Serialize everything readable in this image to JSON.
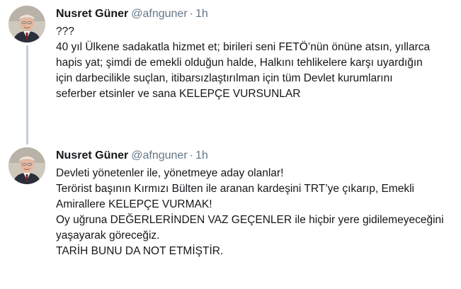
{
  "tweets": [
    {
      "author_name": "Nusret Güner",
      "handle": "@afnguner",
      "separator": "·",
      "time": "1h",
      "lines": [
        "???",
        "40 yıl Ülkene sadakatla hizmet et; birileri seni FETÖ’nün önüne atsın, yıllarca",
        "hapis yat; şimdi de emekli olduğun halde, Halkını tehlikelere karşı uyardığın",
        "için darbecilikle suçlan, itibarsızlaştırılman için tüm Devlet kurumlarını",
        "seferber etsinler ve sana KELEPÇE VURSUNLAR"
      ]
    },
    {
      "author_name": "Nusret Güner",
      "handle": "@afnguner",
      "separator": "·",
      "time": "1h",
      "lines": [
        "Devleti yönetenler ile, yönetmeye aday olanlar!",
        "Terörist başının Kırmızı Bülten ile aranan kardeşini TRT’ye çıkarıp, Emekli",
        "Amirallere KELEPÇE VURMAK!",
        "Oy uğruna DEĞERLERİNDEN VAZ GEÇENLER ile hiçbir yere gidilemeyeceğini",
        "yaşayarak göreceğiz.",
        "TARİH BUNU DA NOT ETMİŞTİR."
      ]
    }
  ]
}
